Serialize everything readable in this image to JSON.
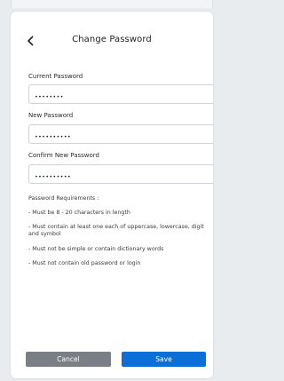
{
  "header": {
    "title": "Change Password",
    "back_icon": "chevron-left-icon"
  },
  "fields": {
    "current": {
      "label": "Current Password",
      "value": "••••••••"
    },
    "new": {
      "label": "New Password",
      "value": "••••••••••"
    },
    "confirm": {
      "label": "Confirm New Password",
      "value": "••••••••••"
    }
  },
  "requirements": {
    "title": "Password Requirements :",
    "items": [
      "- Must be 8 - 20 characters in length",
      "- Must contain at least one each of uppercase, lowercase, digit and symbol",
      "- Must not be simple or contain dictionary words",
      "- Must not contain old password or login"
    ]
  },
  "actions": {
    "cancel_label": "Cancel",
    "save_label": "Save"
  },
  "colors": {
    "save": "#0b6fd7",
    "cancel": "#7a7f85",
    "background": "#e9ecef"
  }
}
